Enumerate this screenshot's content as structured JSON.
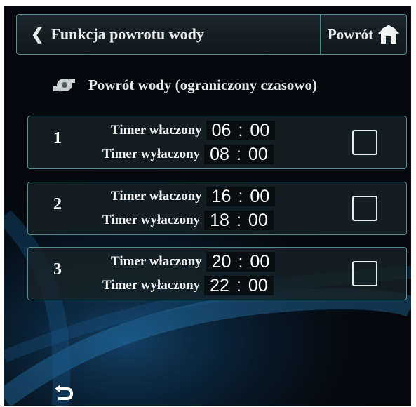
{
  "header": {
    "title": "Funkcja powrotu wody",
    "home_label": "Powrót"
  },
  "subtitle": "Powrót wody (ograniczony czasowo)",
  "timers": [
    {
      "index": "1",
      "on_label": "Timer właczony",
      "on_hour": "06",
      "on_min": "00",
      "off_label": "Timer wyłaczony",
      "off_hour": "08",
      "off_min": "00",
      "enabled": false
    },
    {
      "index": "2",
      "on_label": "Timer właczony",
      "on_hour": "16",
      "on_min": "00",
      "off_label": "Timer wyłaczony",
      "off_hour": "18",
      "off_min": "00",
      "enabled": false
    },
    {
      "index": "3",
      "on_label": "Timer właczony",
      "on_hour": "20",
      "on_min": "00",
      "off_label": "Timer wyłaczony",
      "off_hour": "22",
      "off_min": "00",
      "enabled": false
    }
  ],
  "time_separator": ":",
  "colors": {
    "accent_border": "#4f8e8f",
    "background": "#04080d",
    "wave": "#1e6fae"
  },
  "icons": {
    "back": "chevron-left-icon",
    "home": "home-icon",
    "pump": "pump-icon",
    "return": "return-arrow-icon"
  }
}
